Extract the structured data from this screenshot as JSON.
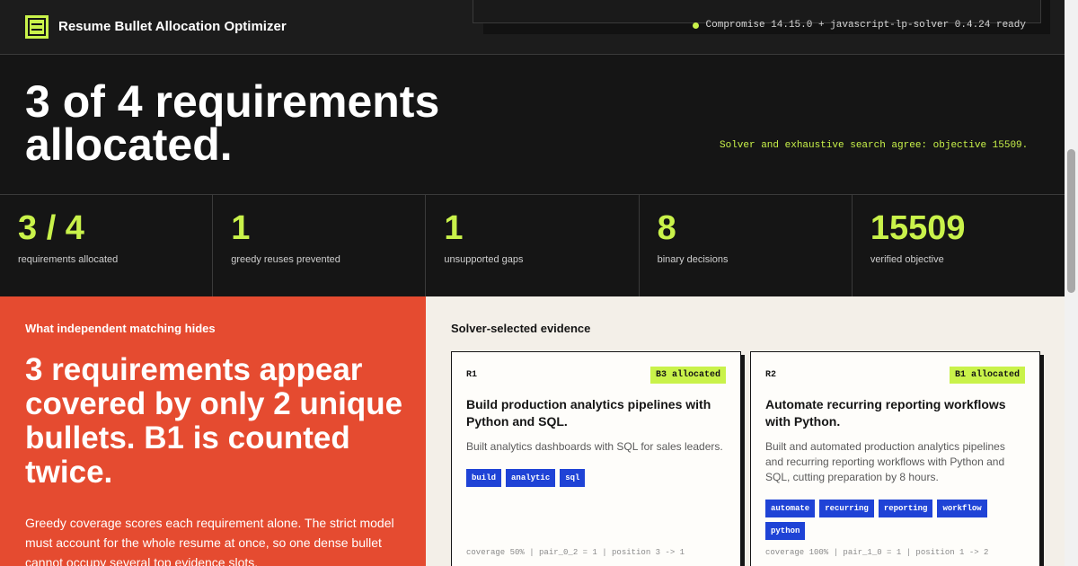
{
  "app": {
    "title": "Resume Bullet Allocation Optimizer",
    "status": "Compromise 14.15.0 + javascript-lp-solver 0.4.24 ready"
  },
  "hero": {
    "title": "3 of 4 requirements allocated.",
    "note": "Solver and exhaustive search agree: objective 15509."
  },
  "stats": [
    {
      "value": "3 / 4",
      "label": "requirements allocated"
    },
    {
      "value": "1",
      "label": "greedy reuses prevented"
    },
    {
      "value": "1",
      "label": "unsupported gaps"
    },
    {
      "value": "8",
      "label": "binary decisions"
    },
    {
      "value": "15509",
      "label": "verified objective"
    }
  ],
  "left": {
    "kicker": "What independent matching hides",
    "headline": "3 requirements appear covered by only 2 unique bullets. B1 is counted twice.",
    "body": "Greedy coverage scores each requirement alone. The strict model must account for the whole resume at once, so one dense bullet cannot occupy several top evidence slots."
  },
  "right": {
    "title": "Solver-selected evidence",
    "cards": [
      {
        "id": "R1",
        "badge": "B3 allocated",
        "title": "Build production analytics pipelines with Python and SQL.",
        "desc": "Built analytics dashboards with SQL for sales leaders.",
        "tags": [
          "build",
          "analytic",
          "sql"
        ],
        "meta": "coverage 50% | pair_0_2 = 1 | position 3 -> 1"
      },
      {
        "id": "R2",
        "badge": "B1 allocated",
        "title": "Automate recurring reporting workflows with Python.",
        "desc": "Built and automated production analytics pipelines and recurring reporting workflows with Python and SQL, cutting preparation by 8 hours.",
        "tags": [
          "automate",
          "recurring",
          "reporting",
          "workflow",
          "python"
        ],
        "meta": "coverage 100% | pair_1_0 = 1 | position 1 -> 2"
      }
    ]
  },
  "colors": {
    "accent": "#c9f24a",
    "alert": "#e54b30",
    "tag": "#1f43d6",
    "dark": "#151515"
  }
}
